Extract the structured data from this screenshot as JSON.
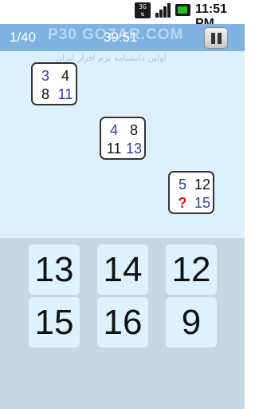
{
  "status_bar": {
    "network_label": "3G",
    "time": "11:51 PM",
    "icons": [
      "3g-icon",
      "signal-icon",
      "battery-icon"
    ]
  },
  "header": {
    "level": "1/40",
    "timer": "39:51",
    "watermark": "P30  GOZAR.COM",
    "pause_icon": "pause-icon"
  },
  "puzzle": {
    "subtitle_watermark": "اولین دانشنامه نرم افزار ایران",
    "squares": [
      {
        "tl": "3",
        "tr": "4",
        "bl": "8",
        "br": "11"
      },
      {
        "tl": "4",
        "tr": "8",
        "bl": "11",
        "br": "13"
      },
      {
        "tl": "5",
        "tr": "12",
        "bl": "?",
        "br": "15"
      }
    ]
  },
  "answers": [
    "13",
    "14",
    "12",
    "15",
    "16",
    "9"
  ],
  "colors": {
    "header_bg": "#7fb2e0",
    "puzzle_bg": "#dcf1fd",
    "answers_bg": "#c7d7e5",
    "answer_tile": "#ddf2fc",
    "number_blue": "#2c3e9c",
    "question_red": "#e01515"
  }
}
